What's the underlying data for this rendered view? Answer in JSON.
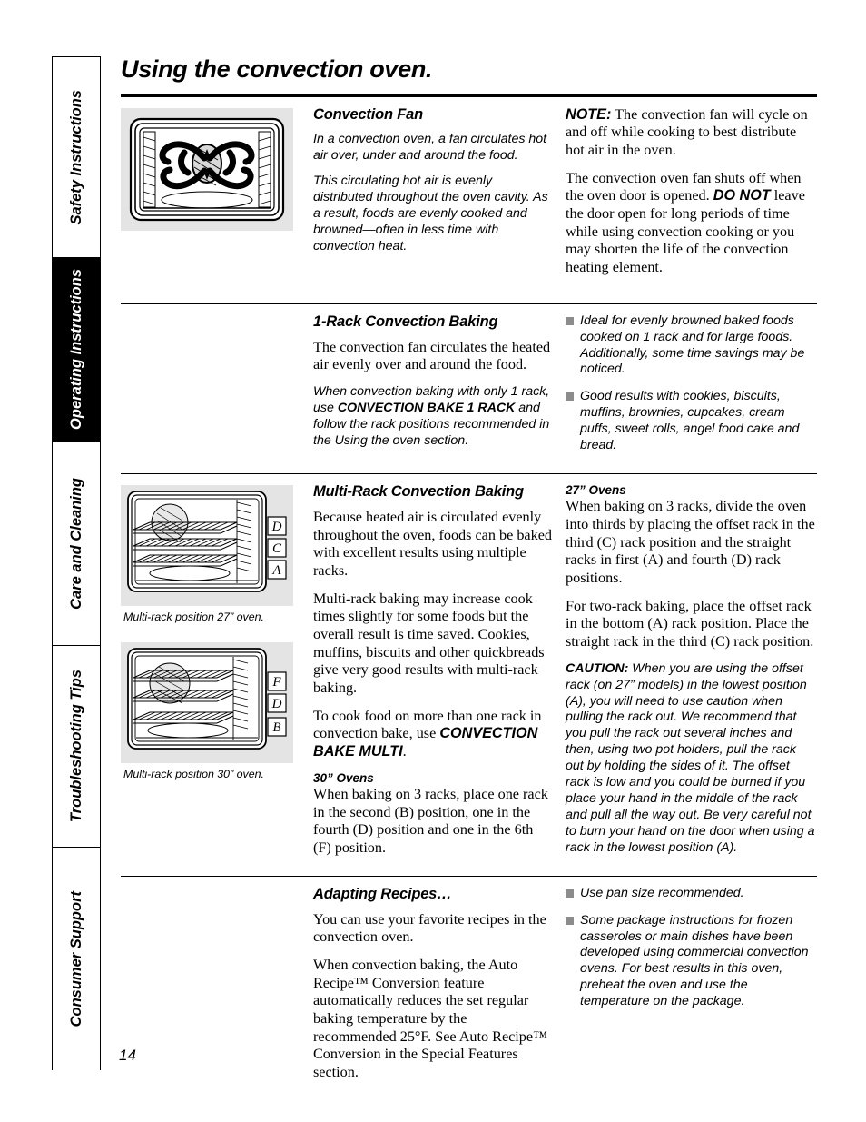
{
  "page": {
    "title": "Using the convection oven.",
    "number": "14"
  },
  "sidebar": {
    "tabs": [
      {
        "label": "Safety Instructions",
        "active": false
      },
      {
        "label": "Operating Instructions",
        "active": true
      },
      {
        "label": "Care and Cleaning",
        "active": false
      },
      {
        "label": "Troubleshooting Tips",
        "active": false
      },
      {
        "label": "Consumer Support",
        "active": false
      }
    ]
  },
  "sections": {
    "convection_fan": {
      "heading": "Convection Fan",
      "figure_caption": "",
      "body1": "In a convection oven, a fan circulates hot air over, under and around the food.",
      "body2": "This circulating hot air is evenly distributed throughout the oven cavity. As a result, foods are evenly cooked and browned—often in less time with convection heat.",
      "note_label": "NOTE:",
      "note_text": " The convection fan will cycle on and off while cooking to best distribute hot air in the oven.",
      "para2_a": "The convection oven fan shuts off when the oven door is opened. ",
      "para2_bold": "DO NOT",
      "para2_b": " leave the door open for long periods of time while using convection cooking or you may shorten the life of the convection heating element."
    },
    "one_rack": {
      "heading": "1-Rack Convection Baking",
      "body1": "The convection fan circulates the heated air evenly over and around the food.",
      "body2_a": "When convection baking with only 1 rack, use ",
      "body2_bold": "CONVECTION BAKE 1 RACK",
      "body2_b": " and follow the rack positions recommended in the Using the oven section.",
      "bullets": [
        "Ideal for evenly browned baked foods cooked on 1 rack and for large foods. Additionally, some time savings may be noticed.",
        "Good results with cookies, biscuits, muffins, brownies, cupcakes, cream puffs, sweet rolls, angel food cake and bread."
      ]
    },
    "multi_rack": {
      "heading": "Multi-Rack Convection Baking",
      "body1": "Because heated air is circulated evenly throughout the oven, foods can be baked with excellent results using multiple racks.",
      "body2": "Multi-rack baking may increase cook times slightly for some foods but the overall result is time saved. Cookies, muffins, biscuits and other quickbreads give very good results with multi-rack baking.",
      "body3_a": "To cook food on more than one rack in convection bake, use ",
      "body3_bold": "CONVECTION BAKE MULTI",
      "body3_b": ".",
      "ovens_30_head": "30” Ovens",
      "ovens_30_body": "When baking on 3 racks, place one rack in the second (B) position, one in the fourth (D) position and one in the 6th (F) position.",
      "ovens_27_head": "27” Ovens",
      "ovens_27_body1": "When baking on 3 racks, divide the oven into thirds by placing the offset rack in the third (C) rack position and the straight racks in first (A) and fourth (D) rack positions.",
      "ovens_27_body2": "For two-rack baking, place the offset rack in the bottom (A) rack position. Place the straight rack in the third (C) rack position.",
      "caution_label": "CAUTION:",
      "caution_text": " When you are using the offset rack (on 27” models) in the lowest position (A), you will need to use caution when pulling the rack out. We recommend that you pull the rack out several inches and then, using two pot holders, pull the rack out by holding the sides of it. The offset rack is low and you could be burned if you place your hand in the middle of the rack and pull all the way out. Be very careful not to burn your hand on the door when using a rack in the lowest position (A).",
      "figure_27": {
        "caption": "Multi-rack position 27” oven.",
        "rack_labels": [
          "D",
          "C",
          "A"
        ]
      },
      "figure_30": {
        "caption": "Multi-rack position 30” oven.",
        "rack_labels": [
          "F",
          "D",
          "B"
        ]
      }
    },
    "adapting": {
      "heading": "Adapting Recipes…",
      "body1": "You can use your favorite recipes in the convection oven.",
      "body2": "When convection baking, the Auto Recipe™ Conversion feature automatically reduces the set regular baking temperature by the recommended 25°F. See Auto Recipe™ Conversion in the Special Features section.",
      "bullets": [
        "Use pan size recommended.",
        "Some package instructions for frozen casseroles or main dishes have been developed using commercial convection ovens. For best results in this oven, preheat the oven and use the temperature on the package."
      ]
    }
  },
  "colors": {
    "figure_background": "#e4e4e4",
    "bullet_square": "#8c8c8c",
    "active_tab_background": "#000000",
    "rule": "#000000"
  }
}
